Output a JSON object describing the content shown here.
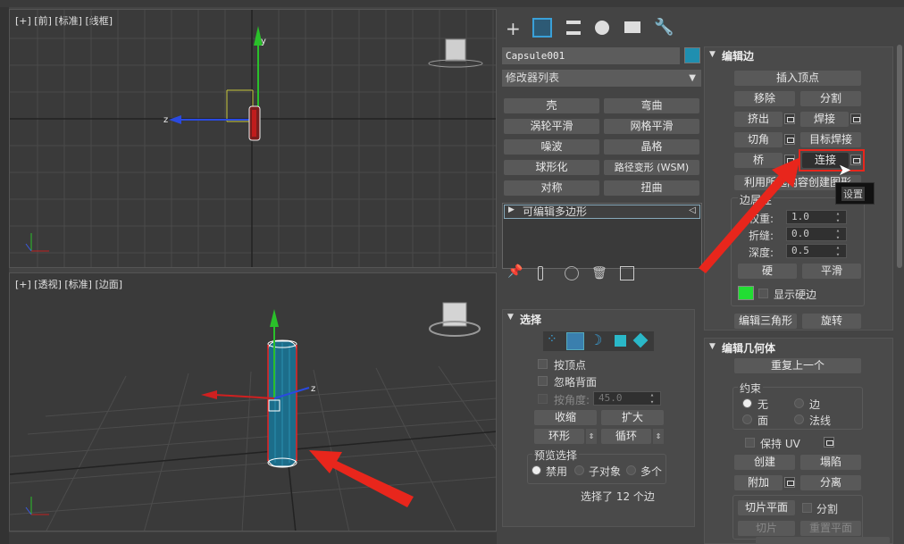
{
  "viewports": {
    "top": {
      "label": "[+] [前] [标准] [线框]"
    },
    "persp": {
      "label": "[+] [透视] [标准] [边面]"
    }
  },
  "toolbar": {
    "icons": [
      "create-icon",
      "modify-icon",
      "hierarchy-icon",
      "motion-icon",
      "display-icon",
      "utilities-icon"
    ]
  },
  "object": {
    "name": "Capsule001",
    "color": "#1f8fb0"
  },
  "modifier_list": {
    "label": "修改器列表"
  },
  "modifier_buttons": [
    "壳",
    "弯曲",
    "涡轮平滑",
    "网格平滑",
    "噪波",
    "晶格",
    "球形化",
    "路径变形 (WSM)",
    "对称",
    "扭曲"
  ],
  "stack": {
    "item": "可编辑多边形"
  },
  "selection": {
    "title": "选择",
    "by_vertex": "按顶点",
    "ignore_backfacing": "忽略背面",
    "by_angle": "按角度:",
    "angle_value": "45.0",
    "shrink": "收缩",
    "grow": "扩大",
    "ring": "环形",
    "loop": "循环",
    "preview_title": "预览选择",
    "preview_off": "禁用",
    "preview_sub": "子对象",
    "preview_multi": "多个",
    "status": "选择了 12 个边"
  },
  "edit_edges": {
    "title": "编辑边",
    "insert_vertex": "插入顶点",
    "remove": "移除",
    "split": "分割",
    "extrude": "挤出",
    "weld": "焊接",
    "chamfer": "切角",
    "target_weld": "目标焊接",
    "bridge": "桥",
    "connect": "连接",
    "create_shape": "利用所选内容创建图形",
    "tooltip": "设置",
    "edge_props": "边属性",
    "weight_label": "权重:",
    "weight": "1.0",
    "crease_label": "折缝:",
    "crease": "0.0",
    "depth_label": "深度:",
    "depth": "0.5",
    "hard": "硬",
    "smooth": "平滑",
    "show_hard": "显示硬边",
    "hard_color": "#22dd33",
    "edit_tri": "编辑三角形",
    "turn": "旋转"
  },
  "edit_geometry": {
    "title": "编辑几何体",
    "repeat_last": "重复上一个",
    "constraints": "约束",
    "none": "无",
    "edge": "边",
    "face": "面",
    "normal": "法线",
    "preserve_uv": "保持 UV",
    "create": "创建",
    "collapse": "塌陷",
    "attach": "附加",
    "detach": "分离",
    "slice_plane": "切片平面",
    "split": "分割",
    "slice": "切片",
    "reset_plane": "重置平面"
  },
  "colors": {
    "highlight": "#e8261c",
    "accent": "#3aa0d8"
  }
}
